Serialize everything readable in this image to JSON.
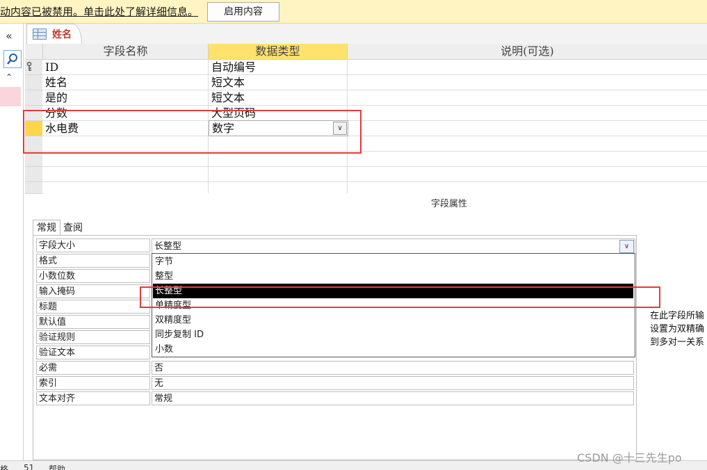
{
  "security_bar": {
    "message": "动内容已被禁用。单击此处了解详细信息。",
    "enable_button": "启用内容"
  },
  "nav": {
    "collapse_glyph": "«",
    "search_icon": "search-icon",
    "up_glyph": "⌃"
  },
  "tab": {
    "label": "姓名"
  },
  "grid": {
    "headers": {
      "field_name": "字段名称",
      "data_type": "数据类型",
      "description": "说明(可选)"
    },
    "rows": [
      {
        "name": "ID",
        "type": "自动编号"
      },
      {
        "name": "姓名",
        "type": "短文本"
      },
      {
        "name": "是的",
        "type": "短文本"
      },
      {
        "name": "分数",
        "type": "大型页码"
      },
      {
        "name": "水电费",
        "type": "数字"
      }
    ]
  },
  "field_properties": {
    "title": "字段属性",
    "tabs": {
      "general": "常规",
      "lookup": "查阅"
    },
    "labels": {
      "field_size": "字段大小",
      "format": "格式",
      "decimal_places": "小数位数",
      "input_mask": "输入掩码",
      "caption": "标题",
      "default_value": "默认值",
      "validation_rule": "验证规则",
      "validation_text": "验证文本",
      "required": "必需",
      "indexed": "索引",
      "text_align": "文本对齐"
    },
    "values": {
      "field_size": "长整型",
      "required": "否",
      "indexed": "无",
      "text_align": "常规"
    },
    "dropdown_options": [
      "字节",
      "整型",
      "长整型",
      "单精度型",
      "双精度型",
      "同步复制 ID",
      "小数"
    ],
    "selected_option": "长整型"
  },
  "hint_lines": [
    "在此字段所输",
    "设置为双精确",
    "到多对一关系"
  ],
  "status_bar": {
    "left1": "格",
    "left2": "51",
    "left3": "帮助"
  },
  "watermark": "CSDN @十三先生po",
  "colors": {
    "security_bar": "#fff4c2",
    "header_selected": "#ffe26b",
    "highlight_red": "#e23b3b",
    "tab_label": "#c0392b"
  }
}
